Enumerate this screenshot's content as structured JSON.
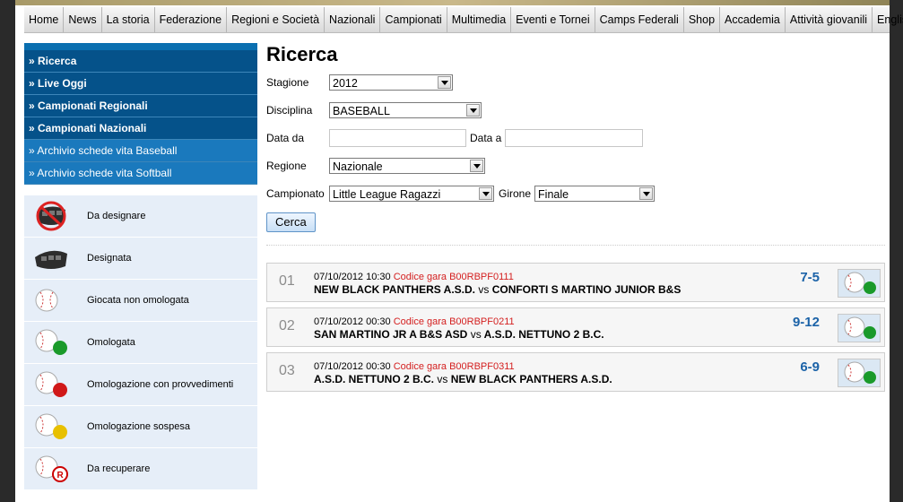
{
  "nav": [
    "Home",
    "News",
    "La storia",
    "Federazione",
    "Regioni e Società",
    "Nazionali",
    "Campionati",
    "Multimedia",
    "Eventi e Tornei",
    "Camps Federali",
    "Shop",
    "Accademia",
    "Attività giovanili",
    "English"
  ],
  "sidebar": {
    "items": [
      "» Ricerca",
      "» Live Oggi",
      "» Campionati Regionali",
      "» Campionati Nazionali",
      "» Archivio schede vita Baseball",
      "» Archivio schede vita Softball"
    ]
  },
  "legend": [
    {
      "label": "Da designare",
      "icon": "mask-crossed-icon"
    },
    {
      "label": "Designata",
      "icon": "mask-icon"
    },
    {
      "label": "Giocata non omologata",
      "icon": "baseball-icon"
    },
    {
      "label": "Omologata",
      "icon": "baseball-green-icon"
    },
    {
      "label": "Omologazione con provvedimenti",
      "icon": "baseball-red-icon"
    },
    {
      "label": "Omologazione sospesa",
      "icon": "baseball-yellow-icon"
    },
    {
      "label": "Da recuperare",
      "icon": "baseball-r-icon"
    }
  ],
  "search": {
    "title": "Ricerca",
    "stagione_label": "Stagione",
    "stagione_value": "2012",
    "disciplina_label": "Disciplina",
    "disciplina_value": "BASEBALL",
    "data_da_label": "Data da",
    "data_a_label": "Data a",
    "regione_label": "Regione",
    "regione_value": "Nazionale",
    "campionato_label": "Campionato",
    "campionato_value": "Little League Ragazzi",
    "girone_label": "Girone",
    "girone_value": "Finale",
    "button": "Cerca"
  },
  "games": [
    {
      "num": "01",
      "date": "07/10/2012 10:30",
      "code": "Codice gara B00RBPF0111",
      "home": "NEW BLACK PANTHERS A.S.D.",
      "vs": "vs",
      "away": "CONFORTI S MARTINO JUNIOR B&S",
      "score": "7-5"
    },
    {
      "num": "02",
      "date": "07/10/2012 00:30",
      "code": "Codice gara B00RBPF0211",
      "home": "SAN MARTINO JR A B&S ASD",
      "vs": "vs",
      "away": "A.S.D. NETTUNO 2 B.C.",
      "score": "9-12"
    },
    {
      "num": "03",
      "date": "07/10/2012 00:30",
      "code": "Codice gara B00RBPF0311",
      "home": "A.S.D. NETTUNO 2 B.C.",
      "vs": "vs",
      "away": "NEW BLACK PANTHERS A.S.D.",
      "score": "6-9"
    }
  ],
  "colors": {
    "nav_bg": "#e6e6e6",
    "sidebar_dark": "#05528a",
    "sidebar_light": "#1a79bd",
    "legend_bg": "#e6eef8",
    "score": "#1c63a8",
    "code": "#d42020"
  }
}
